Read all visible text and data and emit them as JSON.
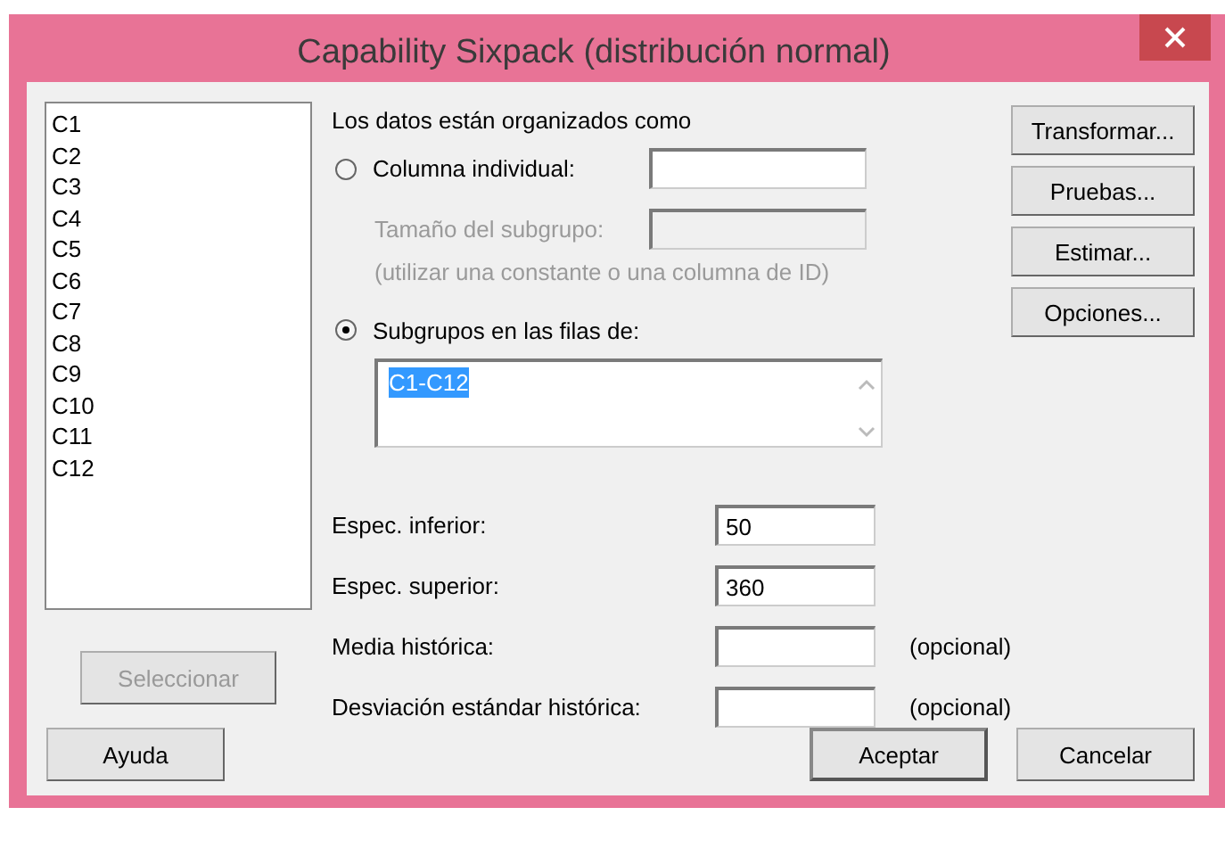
{
  "window": {
    "title": "Capability Sixpack (distribución normal)"
  },
  "variables": {
    "items": [
      "C1",
      "C2",
      "C3",
      "C4",
      "C5",
      "C6",
      "C7",
      "C8",
      "C9",
      "C10",
      "C11",
      "C12"
    ]
  },
  "select_button": {
    "label": "Seleccionar",
    "disabled": true
  },
  "arrangement": {
    "heading": "Los datos están organizados como",
    "options": [
      {
        "kind": "column",
        "label": "Columna individual:",
        "selected": false
      },
      {
        "kind": "rows",
        "label": "Subgrupos en las filas de:",
        "selected": true,
        "value": "C1-C12",
        "value_selected": true
      }
    ],
    "subgroup_size": {
      "label": "Tamaño del subgrupo:",
      "disabled": true
    },
    "hint": {
      "text": "(utilizar una constante o una columna de ID)",
      "disabled": true
    }
  },
  "specs": [
    {
      "label": "Espec. inferior:",
      "value": "50"
    },
    {
      "label": "Espec. superior:",
      "value": "360"
    },
    {
      "label": "Media histórica:",
      "note": "(opcional)"
    },
    {
      "label": "Desviación estándar histórica:",
      "note": "(opcional)"
    }
  ],
  "side_buttons": [
    "Transformar...",
    "Pruebas...",
    "Estimar...",
    "Opciones..."
  ],
  "bottom_buttons": [
    {
      "label": "Ayuda",
      "default": false
    },
    {
      "label": "Aceptar",
      "default": true
    },
    {
      "label": "Cancelar",
      "default": false
    }
  ]
}
